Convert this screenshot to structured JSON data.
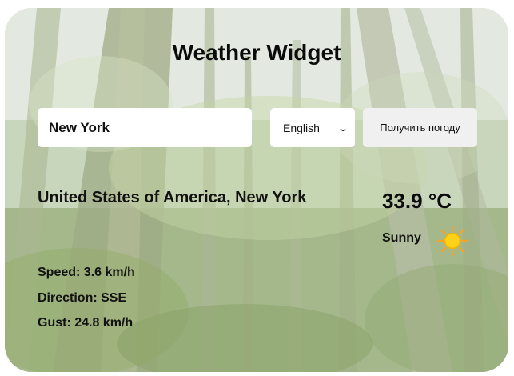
{
  "app": {
    "title": "Weather Widget"
  },
  "search": {
    "city_value": "New York"
  },
  "language": {
    "selected": "English"
  },
  "action": {
    "get_weather_label": "Получить погоду"
  },
  "weather": {
    "location": "United States of America, New York",
    "temperature": "33.9 °C",
    "condition": "Sunny",
    "condition_icon": "sun-icon",
    "speed_text": "Speed: 3.6 km/h",
    "direction_text": "Direction: SSE",
    "gust_text": "Gust: 24.8 km/h"
  },
  "colors": {
    "sun": "#ffd21a",
    "sun_rays": "#f5a623"
  }
}
